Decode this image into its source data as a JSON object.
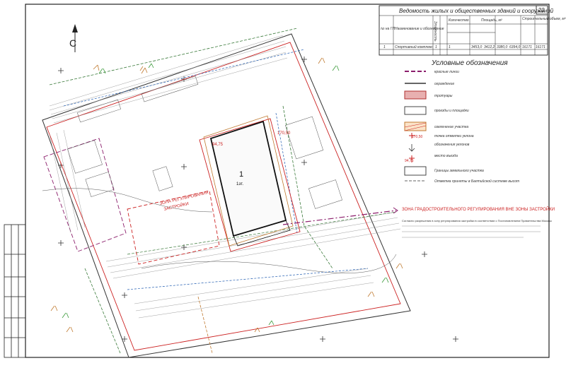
{
  "sheet": {
    "number": "22",
    "table_title": "Ведомость жилых и общественных зданий и сооружений",
    "table_headers": [
      "№ на ГП",
      "Наименование и обозначение",
      "Этажность",
      "Количество",
      "Площадь, м²",
      "Строительный объем, м³"
    ],
    "table_row": [
      "1",
      "Спортивный комплекс",
      "1",
      "",
      "",
      "1",
      "",
      "3453,0",
      "3412,2",
      "3380,0",
      "6394,0",
      "16171",
      "16171"
    ],
    "legend_title": "Условные обозначения",
    "legend_items": [
      {
        "label": "красные линии",
        "color": "#8b1d6b"
      },
      {
        "label": "ограждение",
        "color": "#333333"
      },
      {
        "label": "тротуары",
        "color": "#b03030"
      },
      {
        "label": "проезды и площадки",
        "color": "#333333"
      },
      {
        "label": "озеленение участка",
        "color": "#c07a30"
      },
      {
        "label": "точка отметки уклона",
        "color": "#cc2222"
      },
      {
        "label": "обозначения уклонов",
        "color": "#333333"
      },
      {
        "label": "место въезда",
        "color": "#cc2222"
      }
    ],
    "level_marks": [
      "170,50",
      "94,75"
    ],
    "notes": [
      "Границы земельного участка",
      "Отметка приняты в Балтийской системе высот"
    ],
    "zone_notice": "ЗОНА ГРАДОСТРОИТЕЛЬНОГО РЕГУЛИРОВАНИЯ ВНЕ ЗОНЫ ЗАСТРОЙКИ",
    "zone_text": "Согласно разрешения в зону регулирования застройки в соответствии с Постановлением Правительства Москвы",
    "site_label_lines": [
      "ЗОНА РЕГУЛИРОВАНИЯ",
      "ЗАСТРОЙКИ"
    ],
    "building_label": "1",
    "building_sublabel": "1эт.",
    "north_arrow": "С"
  }
}
